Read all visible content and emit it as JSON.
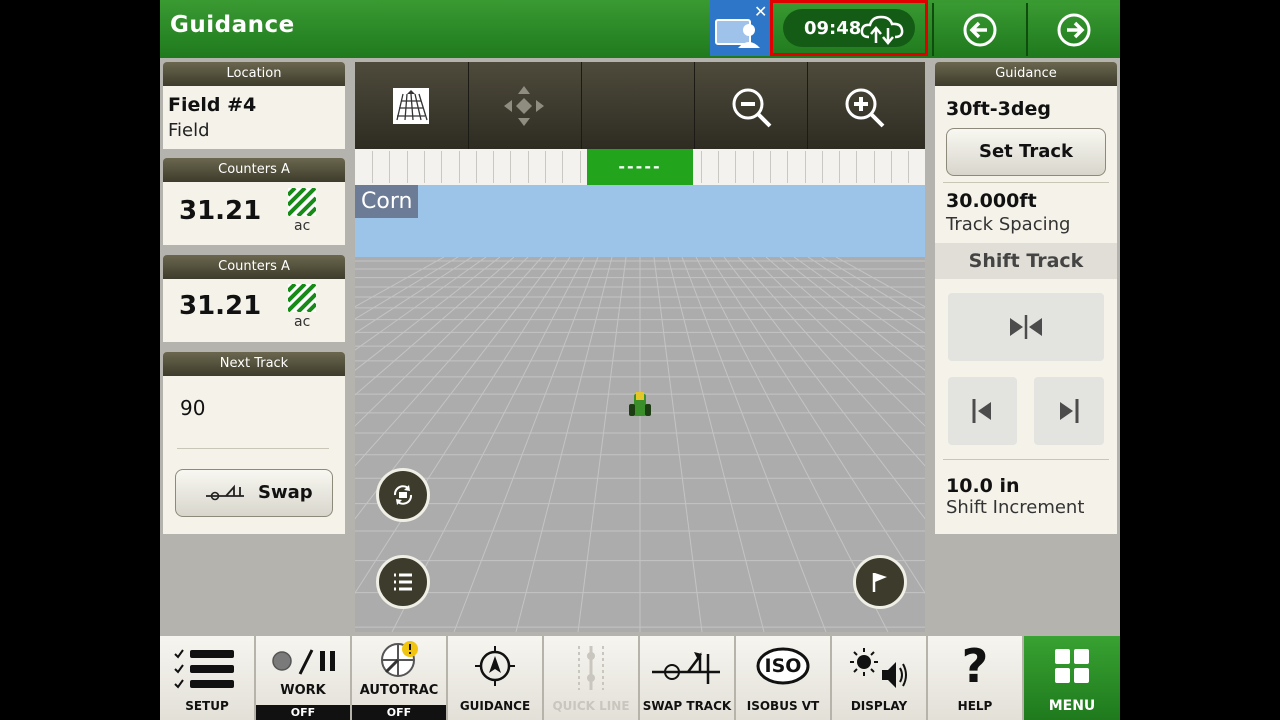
{
  "header": {
    "title": "Guidance",
    "clock": "09:48"
  },
  "left": {
    "location": {
      "heading": "Location",
      "field": "Field #4",
      "type": "Field"
    },
    "counter1": {
      "heading": "Counters A",
      "value": "31.21",
      "unit": "ac"
    },
    "counter2": {
      "heading": "Counters A",
      "value": "31.21",
      "unit": "ac"
    },
    "next_track": {
      "heading": "Next Track",
      "value": "90",
      "swap_label": "Swap"
    }
  },
  "map": {
    "crop_label": "Corn",
    "lightbar_center": "-----"
  },
  "right": {
    "heading": "Guidance",
    "track_name": "30ft-3deg",
    "set_track_label": "Set Track",
    "track_spacing_value": "30.000ft",
    "track_spacing_label": "Track Spacing",
    "shift_track_label": "Shift Track",
    "shift_increment_value": "10.0 in",
    "shift_increment_label": "Shift Increment"
  },
  "bottom": {
    "items": [
      {
        "label": "SETUP"
      },
      {
        "label": "WORK",
        "state": "OFF"
      },
      {
        "label": "AUTOTRAC",
        "state": "OFF"
      },
      {
        "label": "GUIDANCE"
      },
      {
        "label": "QUICK LINE"
      },
      {
        "label": "SWAP TRACK"
      },
      {
        "label": "ISOBUS VT"
      },
      {
        "label": "DISPLAY"
      },
      {
        "label": "HELP"
      },
      {
        "label": "MENU"
      }
    ],
    "iso_text": "ISO"
  },
  "colors": {
    "header_green": "#1f7a1d",
    "clock_highlight": "#e00000",
    "active_green": "#22a51d",
    "menu_green": "#2a8c26"
  }
}
